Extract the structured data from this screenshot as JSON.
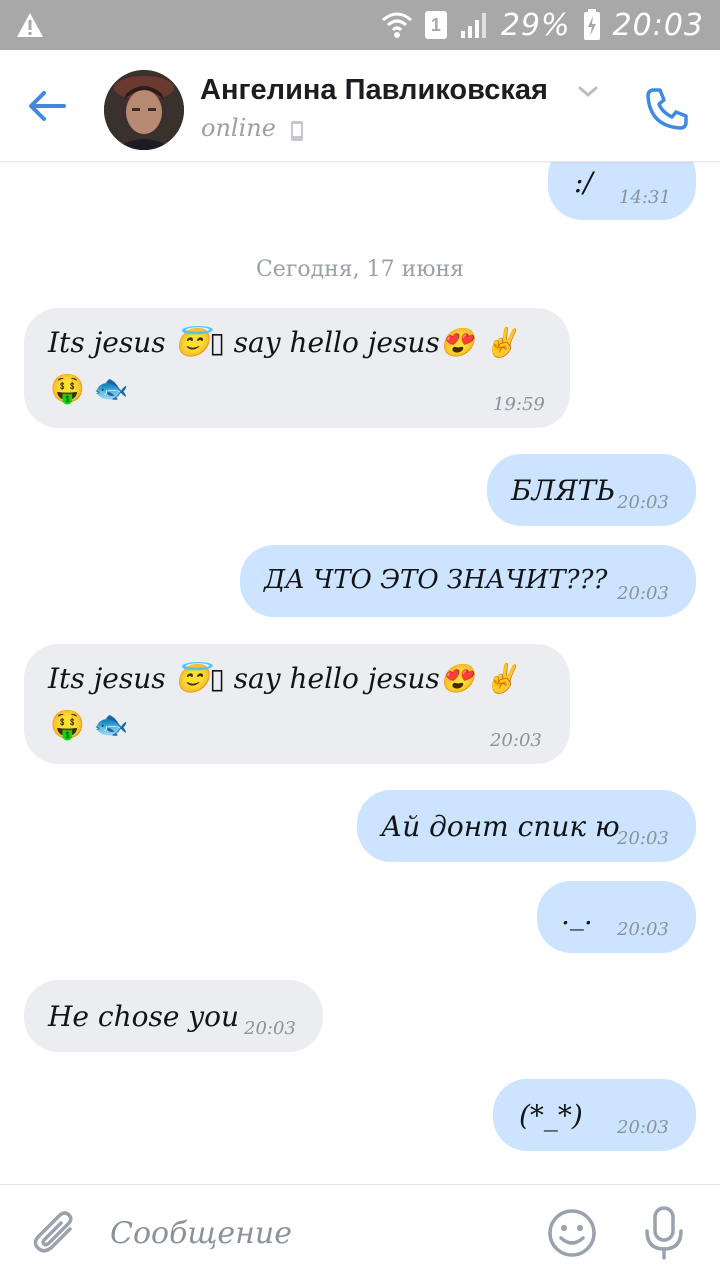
{
  "status_bar": {
    "battery": "29%",
    "sim": "1",
    "time": "20:03"
  },
  "header": {
    "contact_name": "Ангелина Павликовская",
    "presence": "online"
  },
  "chat": {
    "messages": [
      {
        "direction": "out",
        "text": ":/",
        "time": "14:31"
      },
      {
        "direction": "date",
        "text": "Сегодня, 17 июня"
      },
      {
        "direction": "in",
        "text": "Its jesus 😇▯ say hello jesus😍 ✌",
        "text2": "🤑 🐟",
        "time": "19:59"
      },
      {
        "direction": "out",
        "text": "БЛЯТЬ",
        "time": "20:03"
      },
      {
        "direction": "out",
        "text": "ДА ЧТО ЭТО ЗНАЧИТ???",
        "time": "20:03"
      },
      {
        "direction": "in",
        "text": "Its jesus 😇▯ say hello jesus😍 ✌",
        "text2": "🤑 🐟",
        "time": "20:03"
      },
      {
        "direction": "out",
        "text": "Ай донт спик ю",
        "time": "20:03"
      },
      {
        "direction": "out",
        "text": "._.",
        "time": "20:03"
      },
      {
        "direction": "in",
        "text": "He chose you",
        "time": "20:03"
      },
      {
        "direction": "out",
        "text": "(*_*)",
        "time": "20:03"
      }
    ]
  },
  "composer": {
    "placeholder": "Сообщение"
  },
  "colors": {
    "accent": "#3f8ae0",
    "incoming_bubble": "#ebedf0",
    "outgoing_bubble": "#cce4ff",
    "status_bar": "#a8a8a8"
  },
  "icons": [
    "warning-icon",
    "wifi-icon",
    "sim-icon",
    "signal-icon",
    "battery-icon",
    "back-arrow-icon",
    "chevron-down-icon",
    "mobile-device-icon",
    "phone-icon",
    "attach-icon",
    "smile-icon",
    "mic-icon"
  ]
}
